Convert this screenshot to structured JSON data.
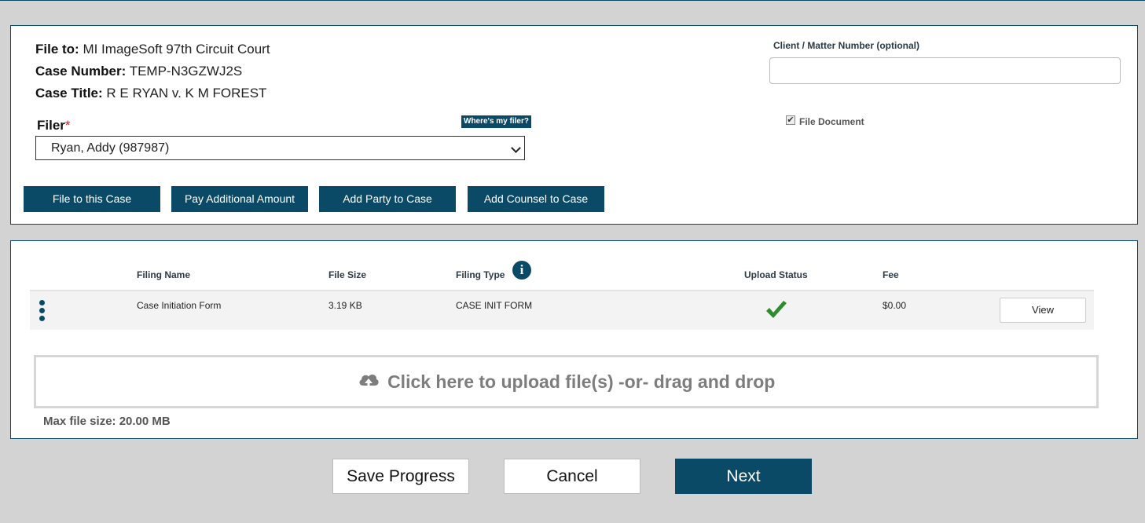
{
  "case": {
    "file_to_label": "File to:",
    "file_to_value": "MI ImageSoft 97th Circuit Court",
    "case_number_label": "Case Number:",
    "case_number_value": "TEMP-N3GZWJ2S",
    "case_title_label": "Case Title:",
    "case_title_value": "R E RYAN v. K M FOREST"
  },
  "filer": {
    "label": "Filer",
    "required_mark": "*",
    "help_button": "Where's my filer?",
    "selected": "Ryan, Addy (987987)"
  },
  "actions": {
    "file_to_case": "File to this Case",
    "pay_additional": "Pay Additional Amount",
    "add_party": "Add Party to Case",
    "add_counsel": "Add Counsel to Case"
  },
  "client_matter": {
    "label": "Client / Matter Number (optional)",
    "value": ""
  },
  "file_document": {
    "label": "File Document",
    "checked": true
  },
  "table": {
    "headers": {
      "name": "Filing Name",
      "size": "File Size",
      "type": "Filing Type",
      "status": "Upload Status",
      "fee": "Fee"
    },
    "rows": [
      {
        "name": "Case Initiation Form",
        "size": "3.19 KB",
        "type": "CASE INIT FORM",
        "status": "uploaded",
        "fee": "$0.00",
        "action": "View"
      }
    ]
  },
  "upload": {
    "text": "Click here to upload file(s) -or- drag and drop",
    "max_size": "Max file size: 20.00 MB"
  },
  "footer": {
    "save": "Save Progress",
    "cancel": "Cancel",
    "next": "Next"
  },
  "colors": {
    "primary": "#0b4a66",
    "background": "#d3d3d3",
    "success": "#2e8b2e",
    "required": "#c0262d"
  },
  "icons": {
    "info": "info-icon",
    "row_menu": "vertical-ellipsis-icon",
    "status": "checkmark-icon",
    "upload": "cloud-upload-icon",
    "select": "chevron-down-icon"
  }
}
